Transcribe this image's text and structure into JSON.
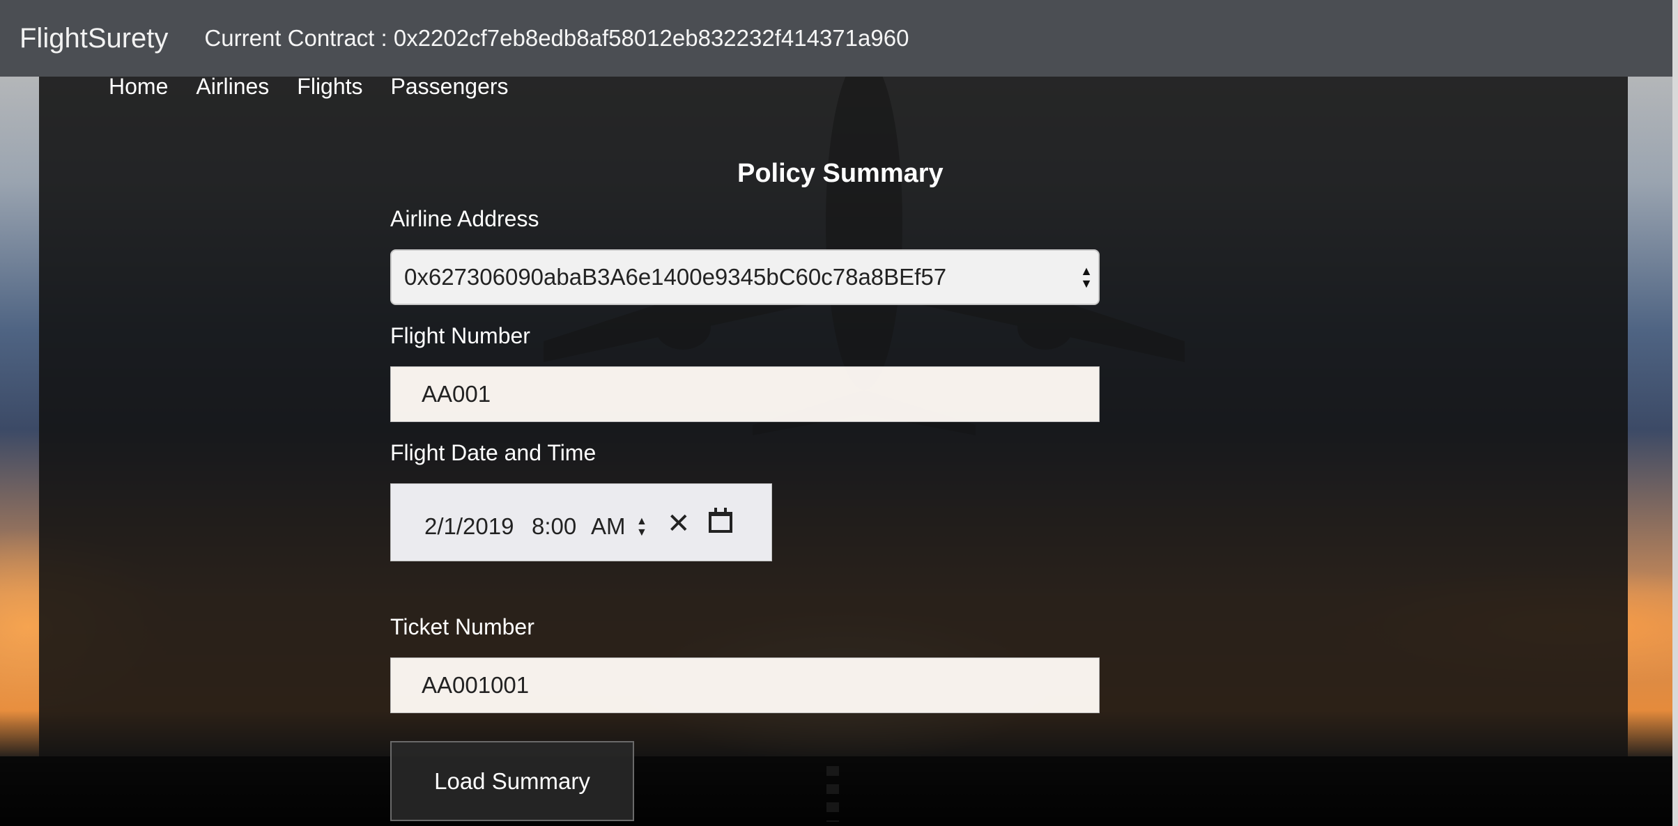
{
  "navbar": {
    "brand": "FlightSurety",
    "contract_label": "Current Contract : 0x2202cf7eb8edb8af58012eb832232f414371a960"
  },
  "subnav": {
    "items": [
      "Home",
      "Airlines",
      "Flights",
      "Passengers"
    ]
  },
  "form": {
    "title": "Policy Summary",
    "airline_address": {
      "label": "Airline Address",
      "value": "0x627306090abaB3A6e1400e9345bC60c78a8BEf57"
    },
    "flight_number": {
      "label": "Flight Number",
      "value": "AA001"
    },
    "flight_datetime": {
      "label": "Flight Date and Time",
      "date": "2/1/2019",
      "time": "8:00",
      "ampm": "AM"
    },
    "ticket_number": {
      "label": "Ticket Number",
      "value": "AA001001"
    },
    "submit_label": "Load Summary"
  }
}
